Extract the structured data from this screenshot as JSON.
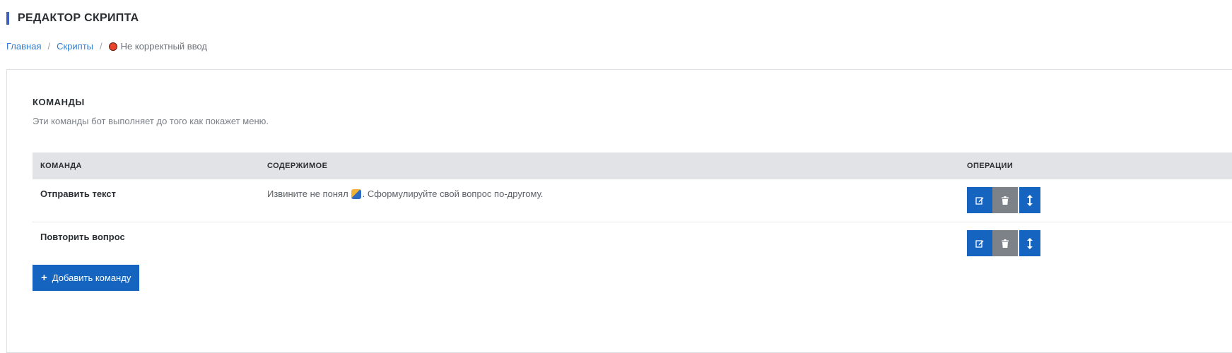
{
  "page": {
    "title": "РЕДАКТОР СКРИПТА"
  },
  "breadcrumb": {
    "home": "Главная",
    "scripts": "Скрипты",
    "current": "Не корректный ввод"
  },
  "commands_section": {
    "title": "КОМАНДЫ",
    "description": "Эти команды бот выполняет до того как покажет меню.",
    "columns": {
      "command": "КОМАНДА",
      "content": "СОДЕРЖИМОЕ",
      "operations": "ОПЕРАЦИИ"
    },
    "rows": [
      {
        "command": "Отправить текст",
        "content_before": "Извините не понял ",
        "content_after": ". Сформулируйте свой вопрос по-другому."
      },
      {
        "command": "Повторить вопрос",
        "content_before": "",
        "content_after": ""
      }
    ],
    "add_button_label": "Добавить команду"
  },
  "colors": {
    "accent": "#1565c0",
    "link": "#2f7dd1",
    "danger_button": "#7d8289",
    "header_bar": "#3f5fbf"
  },
  "icons": {
    "status": "stop-sign-icon",
    "emoji": "thinking-emoji-icon",
    "edit": "edit-icon",
    "delete": "trash-icon",
    "move": "move-vertical-icon",
    "add": "plus-icon"
  }
}
